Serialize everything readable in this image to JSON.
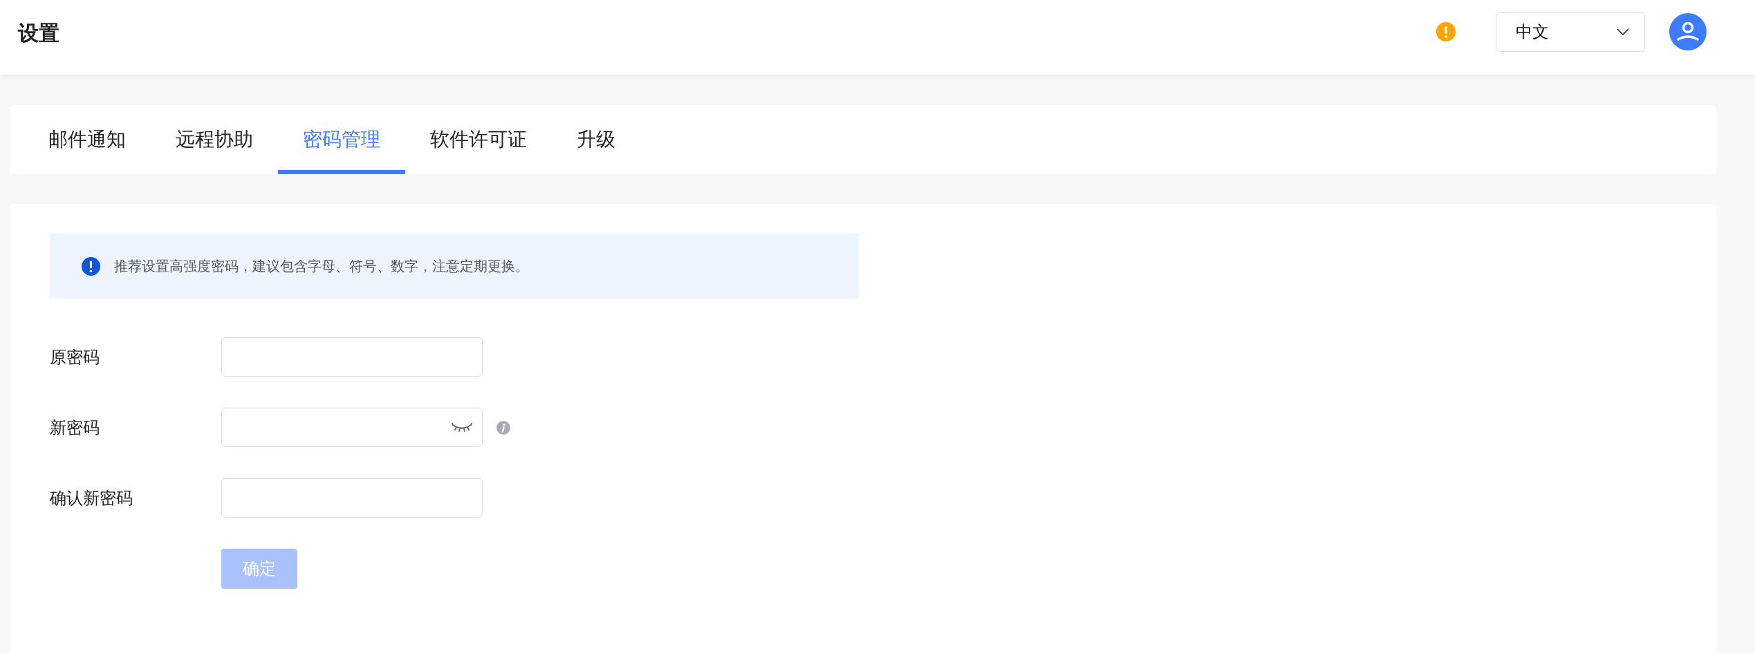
{
  "header": {
    "title": "设置",
    "language": "中文"
  },
  "tabs": [
    {
      "label": "邮件通知",
      "selected": false
    },
    {
      "label": "远程协助",
      "selected": false
    },
    {
      "label": "密码管理",
      "selected": true
    },
    {
      "label": "软件许可证",
      "selected": false
    },
    {
      "label": "升级",
      "selected": false
    }
  ],
  "alert": {
    "text": "推荐设置高强度密码，建议包含字母、符号、数字，注意定期更换。"
  },
  "form": {
    "fields": [
      {
        "label": "原密码",
        "kind": "plain"
      },
      {
        "label": "新密码",
        "kind": "toggle"
      },
      {
        "label": "确认新密码",
        "kind": "plain"
      }
    ],
    "submit": {
      "label": "确定",
      "disabled": true
    }
  }
}
